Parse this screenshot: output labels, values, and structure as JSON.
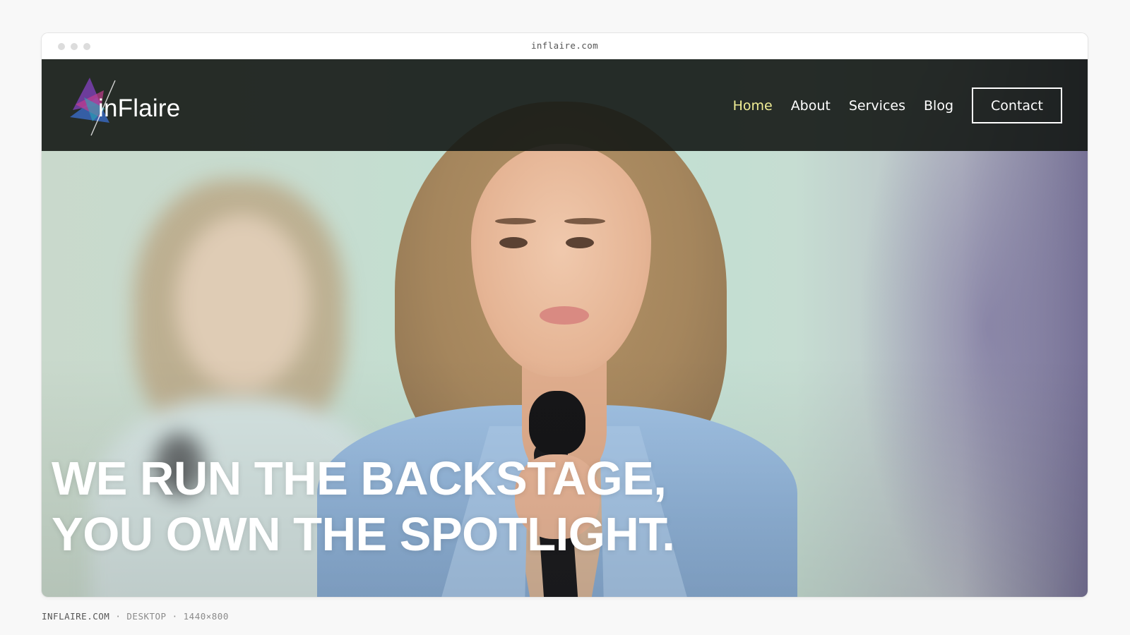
{
  "browser": {
    "url": "inflaire.com"
  },
  "site": {
    "logo_text": "inFlaire",
    "logo_icon": "prism-butterfly-logo-icon",
    "nav": [
      {
        "label": "Home",
        "active": true
      },
      {
        "label": "About",
        "active": false
      },
      {
        "label": "Services",
        "active": false
      },
      {
        "label": "Blog",
        "active": false
      }
    ],
    "contact_label": "Contact"
  },
  "hero": {
    "line1": "WE RUN THE BACKSTAGE,",
    "line2": "YOU OWN THE SPOTLIGHT.",
    "image": "woman-speaking-into-microphone-photo"
  },
  "caption": {
    "site": "INFLAIRE.COM",
    "sep1": " · ",
    "device": "DESKTOP",
    "sep2": " · ",
    "size": "1440×800"
  },
  "colors": {
    "nav_active": "#f1ee95",
    "nav_bg": "#141815",
    "jacket": "#9fc0e2"
  }
}
